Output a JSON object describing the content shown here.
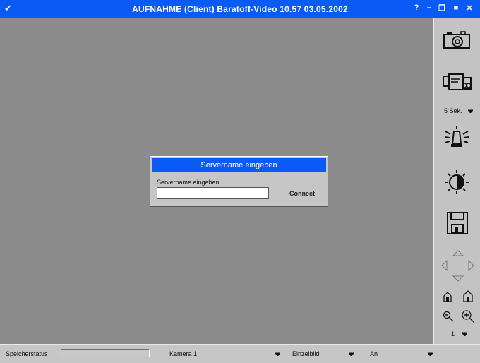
{
  "window": {
    "title": "AUFNAHME (Client) Baratoff-Video  10.57  03.05.2002",
    "menu_glyph": "✔",
    "controls": {
      "help": "?",
      "minimize": "–",
      "restore": "❐",
      "maximize": "■",
      "close": "✕"
    }
  },
  "dialog": {
    "title": "Servername eingeben",
    "field_label": "Servername eingeben",
    "input_value": "",
    "connect_label": "Connect"
  },
  "sidebar": {
    "interval_label": "5 Sek.",
    "page_number": "1",
    "icons": [
      "camera-icon",
      "video-camera-icon",
      "alarm-siren-icon",
      "brightness-icon",
      "floppy-disk-icon",
      "pan-up-icon",
      "pan-left-icon",
      "pan-right-icon",
      "pan-down-icon",
      "home-preset-icon",
      "home-preset-alt-icon",
      "zoom-out-icon",
      "zoom-in-icon"
    ]
  },
  "statusbar": {
    "storage_label": "Speicherstatus",
    "storage_progress": 0,
    "camera": "Kamera 1",
    "mode": "Einzelbild",
    "state": "An"
  },
  "colors": {
    "accent": "#0a5af5",
    "viewport": "#8c8c8c",
    "panel": "#c3c3c3"
  }
}
